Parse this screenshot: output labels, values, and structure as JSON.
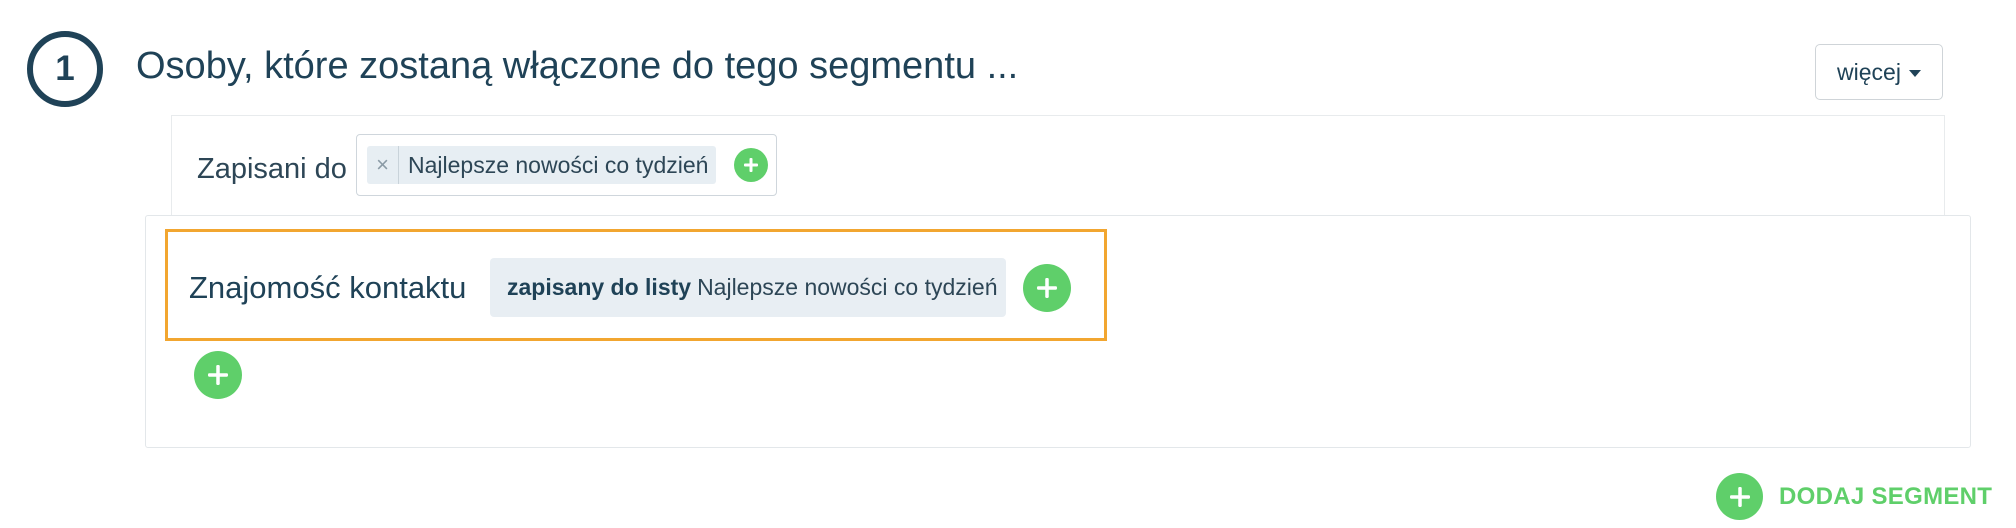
{
  "segment": {
    "number": "1",
    "title": "Osoby, które zostaną włączone do tego segmentu ...",
    "more_button": {
      "label": "więcej"
    }
  },
  "subscribed_filter": {
    "label": "Zapisani do",
    "tags": [
      {
        "label": "Najlepsze nowości co tydzień",
        "remove_glyph": "×"
      }
    ],
    "add_icon": "plus-icon"
  },
  "acquaintance_filter": {
    "label": "Znajomość kontaktu",
    "condition": {
      "operator": "zapisany do listy",
      "value": "Najlepsze nowości co tydzień"
    },
    "add_icon": "plus-icon"
  },
  "add_segment": {
    "label": "DODAJ SEGMENT"
  },
  "colors": {
    "primary_text": "#1f4257",
    "accent_green": "#5fcf6a",
    "highlight_orange": "#f2a630",
    "chip_background": "#e8eef3"
  }
}
